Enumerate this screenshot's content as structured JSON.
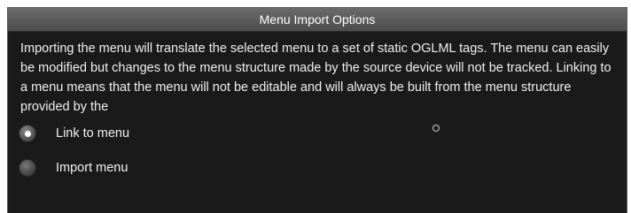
{
  "dialog": {
    "title": "Menu Import Options",
    "description": "Importing the menu will translate the selected menu to a set of static OGLML tags.  The menu can easily be modified but changes to the menu structure made by the source device will not be tracked.  Linking to a menu means that the menu will not be editable and will always be built from the menu structure provided by the",
    "options": [
      {
        "label": "Link to menu",
        "selected": true
      },
      {
        "label": "Import menu",
        "selected": false
      }
    ]
  },
  "colors": {
    "background": "#1a1a1a",
    "title_bar": "#5a5a5a",
    "text": "#f0f0f0"
  }
}
